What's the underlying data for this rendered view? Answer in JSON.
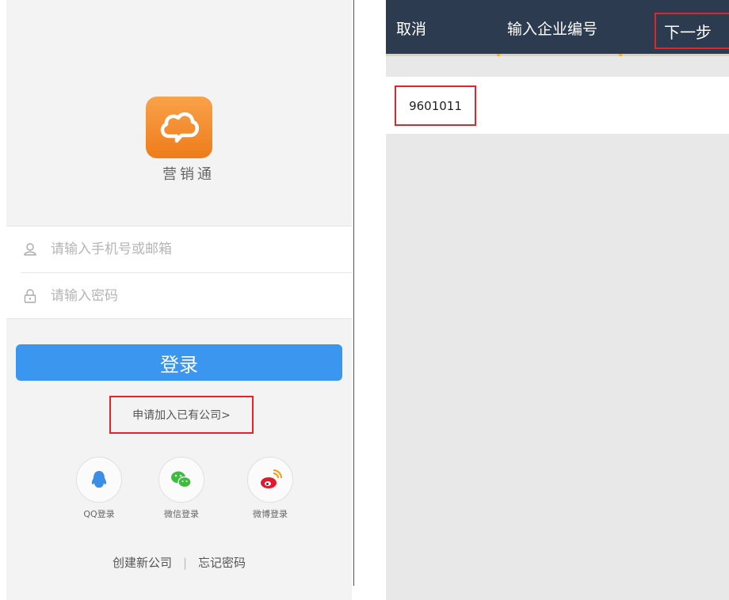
{
  "login": {
    "app_name": "营销通",
    "phone_placeholder": "请输入手机号或邮箱",
    "password_placeholder": "请输入密码",
    "login_label": "登录",
    "join_company_label": "申请加入已有公司>",
    "social": [
      {
        "label": "QQ登录",
        "icon": "qq-icon",
        "color": "#3a8ee6"
      },
      {
        "label": "微信登录",
        "icon": "wechat-icon",
        "color": "#3fbb3f"
      },
      {
        "label": "微博登录",
        "icon": "weibo-icon",
        "color": "#e6162d"
      }
    ],
    "create_company_label": "创建新公司",
    "forgot_password_label": "忘记密码"
  },
  "enterprise": {
    "cancel_label": "取消",
    "title": "输入企业编号",
    "next_label": "下一步",
    "code_value": "9601011"
  },
  "colors": {
    "accent_blue": "#3a96ee",
    "nav_bg": "#2d3b50",
    "logo_orange": "#ee7c1a",
    "highlight_red": "#e0262b"
  }
}
